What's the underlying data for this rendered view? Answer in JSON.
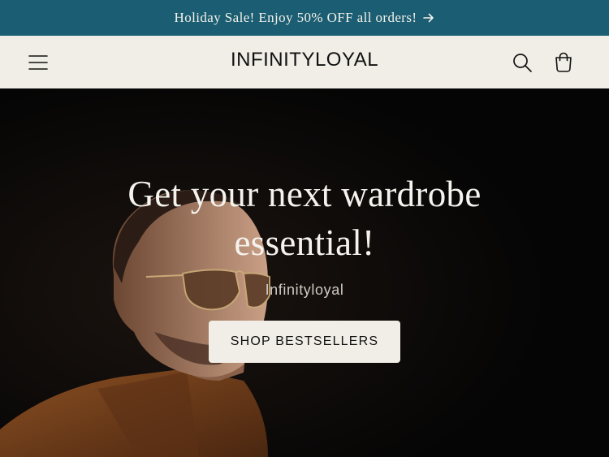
{
  "announcement": {
    "text": "Holiday Sale! Enjoy 50% OFF all orders!",
    "arrow_icon": "arrow-right-icon"
  },
  "header": {
    "logo": "INFINITYLOYAL",
    "menu_icon": "hamburger-menu-icon",
    "search_icon": "search-icon",
    "cart_icon": "shopping-bag-icon"
  },
  "hero": {
    "title": "Get your next wardrobe essential!",
    "subtitle": "Infinityloyal",
    "button_label": "SHOP BESTSELLERS"
  },
  "colors": {
    "announcement_bg": "#1b5d72",
    "header_bg": "#f1eee7",
    "hero_bg": "#0a0a0a",
    "button_bg": "#f1eee7"
  }
}
